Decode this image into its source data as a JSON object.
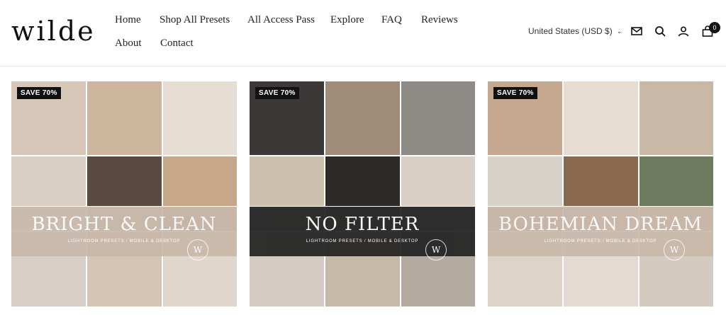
{
  "brand": {
    "logo_text": "wilde"
  },
  "nav": {
    "items": [
      {
        "label": "Home"
      },
      {
        "label": "Shop All Presets"
      },
      {
        "label": "All Access Pass"
      },
      {
        "label": "Explore"
      },
      {
        "label": "FAQ"
      },
      {
        "label": "Reviews"
      },
      {
        "label": "About"
      },
      {
        "label": "Contact"
      }
    ]
  },
  "header": {
    "currency": "United States (USD $)",
    "icons": [
      "mail-icon",
      "search-icon",
      "account-icon",
      "cart-icon"
    ],
    "cart_count": "0"
  },
  "products": [
    {
      "badge": "SAVE 70%",
      "title": "BRIGHT & CLEAN",
      "subtitle": "LIGHTROOM PRESETS / MOBILE & DESKTOP",
      "seal": "W",
      "banner_color": "#c9b9ab",
      "tile_colors": [
        "#d7c7b8",
        "#cdb69d",
        "#e6ddd3",
        "#d9cfc4",
        "#5b4a40",
        "#c6a789",
        "#e3ddd6",
        "#c2b6aa",
        "#b79d85",
        "#d8d0c8",
        "#d6c5b2",
        "#e0d6cc"
      ]
    },
    {
      "badge": "SAVE 70%",
      "title": "NO FILTER",
      "subtitle": "LIGHTROOM PRESETS / MOBILE & DESKTOP",
      "seal": "W",
      "banner_color": "#262626",
      "tile_colors": [
        "#3b3837",
        "#a08c78",
        "#8e8a85",
        "#cdbfae",
        "#2d2a29",
        "#d9cfc5",
        "#bfb3a7",
        "#a79d94",
        "#c9c1b8",
        "#d4ccc3",
        "#c6b9a8",
        "#b3aaa0"
      ]
    },
    {
      "badge": "SAVE 70%",
      "title": "BOHEMIAN DREAM",
      "subtitle": "LIGHTROOM PRESETS / MOBILE & DESKTOP",
      "seal": "W",
      "banner_color": "#c9b9ab",
      "tile_colors": [
        "#c4a890",
        "#e6dcd2",
        "#c9b8a6",
        "#d9d2ca",
        "#8a6a4f",
        "#6e7a5e",
        "#b59b84",
        "#cdb8a2",
        "#c7aa8b",
        "#ddd3c8",
        "#e3dbd2",
        "#d5cac0"
      ]
    }
  ]
}
